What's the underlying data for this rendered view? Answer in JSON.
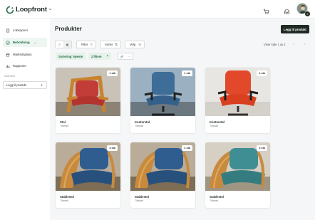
{
  "app": {
    "name": "Loopfront",
    "tm": "™"
  },
  "colors": {
    "brand_green": "#1d6b45",
    "dark": "#1f2a24",
    "chip_bg": "#e6f2ea"
  },
  "header_icons": [
    "cart-icon",
    "inbox-icon"
  ],
  "user": {
    "avatar_badge": "2"
  },
  "sidebar": {
    "items": [
      {
        "label": "Lokasjoner",
        "icon": "building-icon",
        "active": false
      },
      {
        "label": "Beholdning",
        "icon": "check-circle-icon",
        "active": true
      },
      {
        "label": "Markedsplass",
        "icon": "store-icon",
        "active": false
      },
      {
        "label": "Rapporter",
        "icon": "bar-chart-icon",
        "active": false
      }
    ],
    "shortcuts_label": "Snarveier",
    "shortcut_button": "Legg til produkt"
  },
  "page": {
    "title": "Produkter",
    "add_button": "Legg til produkt",
    "toolbar": {
      "filter": "Filter",
      "sort": "Sorter",
      "select": "Velg"
    },
    "showing": "Viser side 1 av 1",
    "chips": {
      "sort": "Sortering: Nyeste",
      "filters": "2 filtere",
      "clear": "×"
    }
  },
  "products": [
    {
      "name": "Stol",
      "category": "Tilbetalt",
      "count": "1 stk",
      "color": "red-wood"
    },
    {
      "name": "Kontorstol",
      "category": "Tilbetalt",
      "count": "1 stk",
      "color": "blue-office"
    },
    {
      "name": "Kontorstol",
      "category": "Tilbetalt",
      "count": "1 stk",
      "color": "red-office"
    },
    {
      "name": "Stablestol",
      "category": "Tilbetalt",
      "count": "4 stk",
      "color": "blue-wood"
    },
    {
      "name": "Stablestol",
      "category": "Tilbetalt",
      "count": "2 stk",
      "color": "blue-wood"
    },
    {
      "name": "Stablestol",
      "category": "Tilbetalt",
      "count": "3 stk",
      "color": "teal-wood"
    }
  ]
}
